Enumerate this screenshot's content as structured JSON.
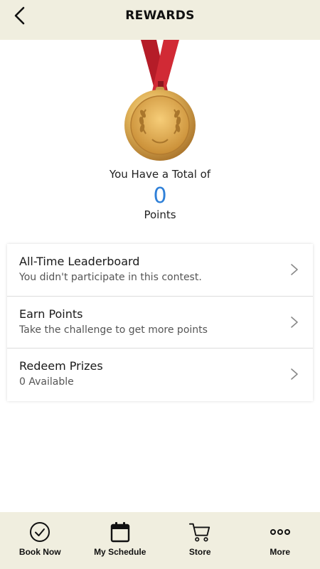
{
  "header": {
    "title": "REWARDS",
    "back_icon": "back-arrow-icon"
  },
  "summary": {
    "total_label": "You Have a Total of",
    "points_value": "0",
    "points_label": "Points",
    "medal_icon": "gold-medal-icon"
  },
  "menu": {
    "items": [
      {
        "title": "All-Time Leaderboard",
        "subtitle": "You didn't participate in this contest."
      },
      {
        "title": "Earn Points",
        "subtitle": "Take the challenge to get more points"
      },
      {
        "title": "Redeem Prizes",
        "subtitle": "0 Available"
      }
    ]
  },
  "tabbar": {
    "tabs": [
      {
        "label": "Book Now",
        "icon": "check-circle-icon"
      },
      {
        "label": "My Schedule",
        "icon": "calendar-icon"
      },
      {
        "label": "Store",
        "icon": "cart-icon"
      },
      {
        "label": "More",
        "icon": "more-dots-icon"
      }
    ]
  },
  "colors": {
    "header_bg": "#f0eedf",
    "points_accent": "#2f80d8",
    "ribbon": "#c8202c",
    "medal_gold": "#d9a647"
  }
}
